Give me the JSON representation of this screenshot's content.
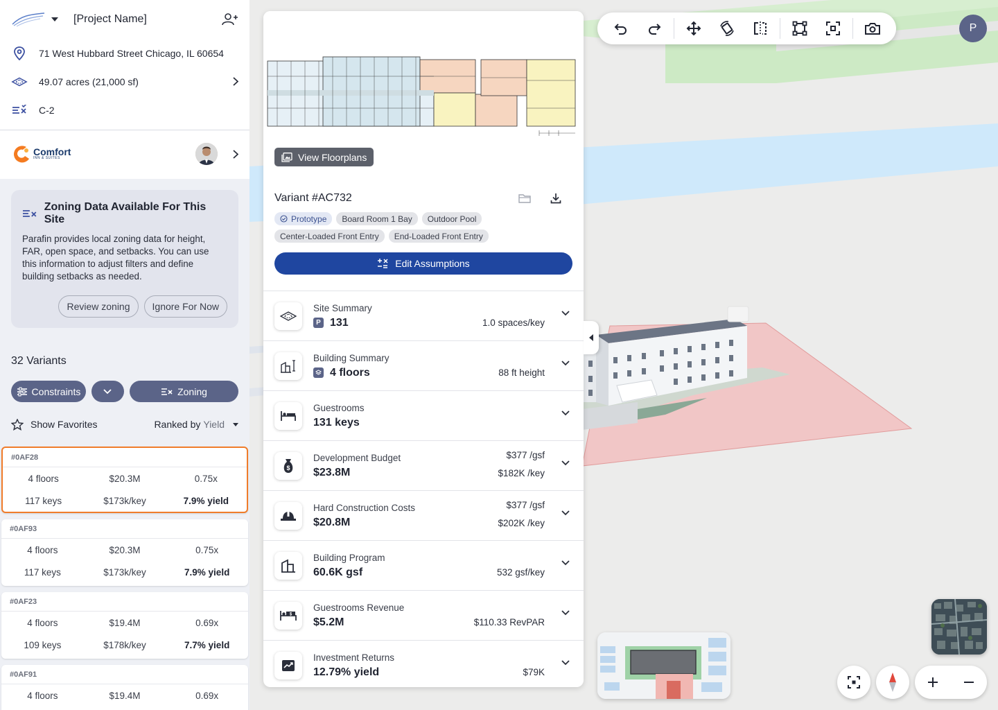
{
  "project": {
    "name": "[Project Name]",
    "address": "71 West Hubbard Street Chicago, IL 60654",
    "acreage": "49.07 acres (21,000 sf)",
    "zoning_code": "C-2"
  },
  "brand": {
    "name": "Comfort",
    "sub": "INN & SUITES"
  },
  "zoning_card": {
    "title": "Zoning Data Available For This Site",
    "body": "Parafin provides local zoning data for height, FAR, open space, and setbacks. You can use this information to adjust filters and define building setbacks as needed.",
    "review_label": "Review zoning",
    "ignore_label": "Ignore For Now"
  },
  "variants": {
    "count_label": "32 Variants",
    "constraints_label": "Constraints",
    "zoning_label": "Zoning",
    "favorites_label": "Show Favorites",
    "ranked_label": "Ranked by",
    "ranked_value": "Yield",
    "items": [
      {
        "id": "#0AF28",
        "floors": "4 floors",
        "cost": "$20.3M",
        "ratio": "0.75x",
        "keys": "117 keys",
        "per_key": "$173k/key",
        "yield": "7.9% yield",
        "selected": true
      },
      {
        "id": "#0AF93",
        "floors": "4 floors",
        "cost": "$20.3M",
        "ratio": "0.75x",
        "keys": "117 keys",
        "per_key": "$173k/key",
        "yield": "7.9% yield"
      },
      {
        "id": "#0AF23",
        "floors": "4 floors",
        "cost": "$19.4M",
        "ratio": "0.69x",
        "keys": "109 keys",
        "per_key": "$178k/key",
        "yield": "7.7% yield"
      },
      {
        "id": "#0AF91",
        "floors": "4 floors",
        "cost": "$19.4M",
        "ratio": "0.69x",
        "keys": "",
        "per_key": "",
        "yield": ""
      }
    ]
  },
  "detail": {
    "view_floorplans": "View Floorplans",
    "variant_name": "Variant #AC732",
    "tags": [
      "Prototype",
      "Board Room 1 Bay",
      "Outdoor Pool",
      "Center-Loaded Front Entry",
      "End-Loaded Front Entry"
    ],
    "edit_label": "Edit Assumptions",
    "sections": [
      {
        "label": "Site Summary",
        "value": "131",
        "badge": "P",
        "right1": "1.0 spaces/key",
        "right2": ""
      },
      {
        "label": "Building Summary",
        "value": "4 floors",
        "badge": "layers",
        "right1": "88 ft height",
        "right2": ""
      },
      {
        "label": "Guestrooms",
        "value": "131 keys",
        "right1": "",
        "right2": ""
      },
      {
        "label": "Development Budget",
        "value": "$23.8M",
        "right1": "$377 /gsf",
        "right2": "$182K /key"
      },
      {
        "label": "Hard Construction Costs",
        "value": "$20.8M",
        "right1": "$377 /gsf",
        "right2": "$202K /key"
      },
      {
        "label": "Building Program",
        "value": "60.6K gsf",
        "right1": "532 gsf/key",
        "right2": ""
      },
      {
        "label": "Guestrooms Revenue",
        "value": "$5.2M",
        "right1": "$110.33 RevPAR",
        "right2": ""
      },
      {
        "label": "Investment Returns",
        "value": "12.79% yield",
        "right1": "$79K",
        "right2": ""
      }
    ]
  },
  "user": {
    "initial": "P"
  },
  "colors": {
    "accent_blue": "#1f46a0",
    "selected_border": "#f07c2a",
    "slate": "#5b6488"
  }
}
